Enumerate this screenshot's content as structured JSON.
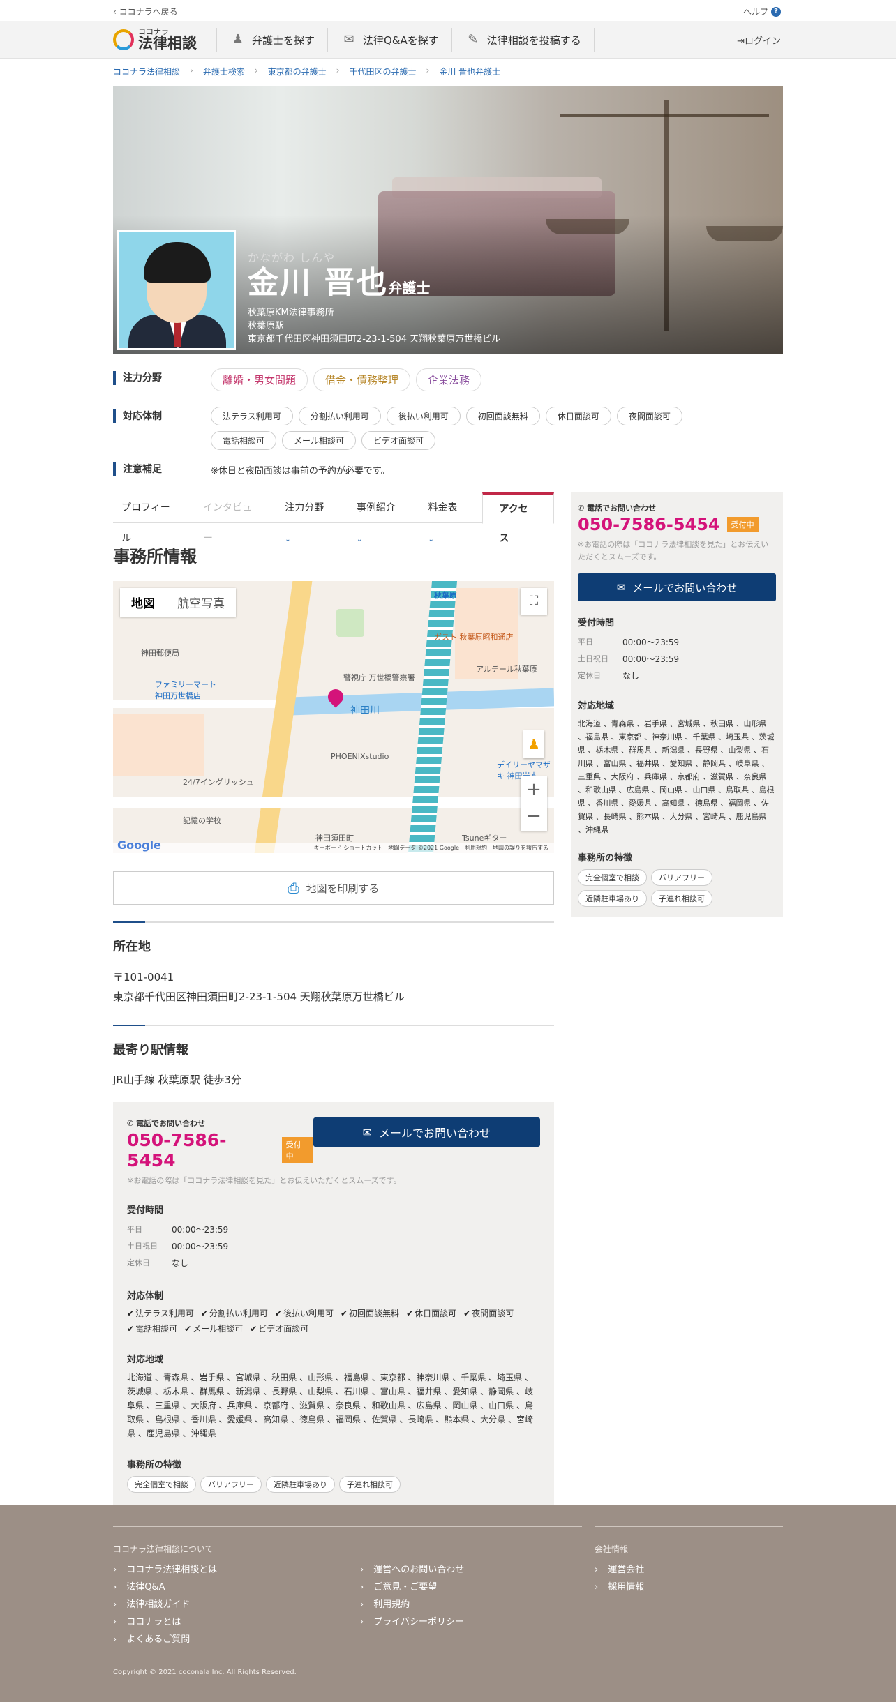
{
  "topbar": {
    "back": "ココナラへ戻る",
    "help": "ヘルプ",
    "help_icon_glyph": "?"
  },
  "header": {
    "logo_small": "ココナラ",
    "logo_big": "法律相談",
    "nav": [
      {
        "label": "弁護士を探す",
        "icon": "lawyer-icon"
      },
      {
        "label": "法律Q&Aを探す",
        "icon": "qa-icon"
      },
      {
        "label": "法律相談を投稿する",
        "icon": "post-icon"
      }
    ],
    "login": "ログイン"
  },
  "breadcrumb": [
    "ココナラ法律相談",
    "弁護士検索",
    "東京都の弁護士",
    "千代田区の弁護士",
    "金川 晋也弁護士"
  ],
  "profile": {
    "kana": "かながわ しんや",
    "name": "金川 晋也",
    "suffix": "弁護士",
    "office": "秋葉原KM法律事務所",
    "station": "秋葉原駅",
    "address": "東京都千代田区神田須田町2-23-1-504 天翔秋葉原万世橋ビル"
  },
  "rows": {
    "specialty_label": "注力分野",
    "specialties": [
      "離婚・男女問題",
      "借金・債務整理",
      "企業法務"
    ],
    "support_label": "対応体制",
    "support": [
      "法テラス利用可",
      "分割払い利用可",
      "後払い利用可",
      "初回面談無料",
      "休日面談可",
      "夜間面談可",
      "電話相談可",
      "メール相談可",
      "ビデオ面談可"
    ],
    "note_label": "注意補足",
    "note": "※休日と夜間面談は事前の予約が必要です。"
  },
  "tabs": [
    {
      "label": "プロフィール"
    },
    {
      "label": "インタビュー"
    },
    {
      "label": "注力分野",
      "dd": "⌄"
    },
    {
      "label": "事例紹介",
      "dd": "⌄"
    },
    {
      "label": "料金表",
      "dd": "⌄"
    },
    {
      "label": "アクセス"
    }
  ],
  "main": {
    "title": "事務所情報",
    "map": {
      "tab_map": "地図",
      "tab_sat": "航空写真",
      "footer": "キーボード ショートカット　地図データ ©2021 Google　利用規約　地図の誤りを報告する",
      "logo": "Google",
      "labels": [
        "秋葉原",
        "神田郵便局",
        "ファミリーマート 神田万世橋店",
        "警視庁 万世橋警察署",
        "神田川",
        "PHOENIXstudio",
        "24/7イングリッシュ",
        "記憶の学校",
        "神田須田町",
        "ガスト 秋葉原昭和通店",
        "アルテール秋葉原",
        "デイリーヤマザキ 神田岩本",
        "Tsuneギター"
      ]
    },
    "print": "地図を印刷する",
    "address_title": "所在地",
    "zip": "〒101-0041",
    "address": "東京都千代田区神田須田町2-23-1-504 天翔秋葉原万世橋ビル",
    "station_title": "最寄り駅情報",
    "station": "JR山手線 秋葉原駅 徒歩3分"
  },
  "contact": {
    "tel_label": "電話でお問い合わせ",
    "tel": "050-7586-5454",
    "badge": "受付中",
    "mail": "メールでお問い合わせ",
    "note": "※お電話の際は「ココナラ法律相談を見た」とお伝えいただくとスムーズです。",
    "hours_title": "受付時間",
    "hours": [
      {
        "k": "平日",
        "v": "00:00〜23:59"
      },
      {
        "k": "土日祝日",
        "v": "00:00〜23:59"
      },
      {
        "k": "定休日",
        "v": "なし"
      }
    ],
    "support_title": "対応体制",
    "area_title": "対応地域",
    "areas": "北海道 、青森県 、岩手県 、宮城県 、秋田県 、山形県 、福島県 、東京都 、神奈川県 、千葉県 、埼玉県 、茨城県 、栃木県 、群馬県 、新潟県 、長野県 、山梨県 、石川県 、富山県 、福井県 、愛知県 、静岡県 、岐阜県 、三重県 、大阪府 、兵庫県 、京都府 、滋賀県 、奈良県 、和歌山県 、広島県 、岡山県 、山口県 、鳥取県 、島根県 、香川県 、愛媛県 、高知県 、徳島県 、福岡県 、佐賀県 、長崎県 、熊本県 、大分県 、宮崎県 、鹿児島県 、沖縄県",
    "feature_title": "事務所の特徴",
    "features": [
      "完全個室で相談",
      "バリアフリー",
      "近隣駐車場あり",
      "子連れ相談可"
    ]
  },
  "footer": {
    "about": "ココナラ法律相談について",
    "col1": [
      "ココナラ法律相談とは",
      "法律Q&A",
      "法律相談ガイド",
      "ココナラとは",
      "よくあるご質問"
    ],
    "col2": [
      "運営へのお問い合わせ",
      "ご意見・ご要望",
      "利用規約",
      "プライバシーポリシー"
    ],
    "company": "会社情報",
    "col3": [
      "運営会社",
      "採用情報"
    ],
    "copyright": "Copyright © 2021 coconala Inc. All Rights Reserved."
  },
  "colors": {
    "accent_pink": "#d4137a",
    "navy": "#0e3d74",
    "badge_orange": "#f29b2d",
    "footer_bg": "#9c8f86"
  }
}
